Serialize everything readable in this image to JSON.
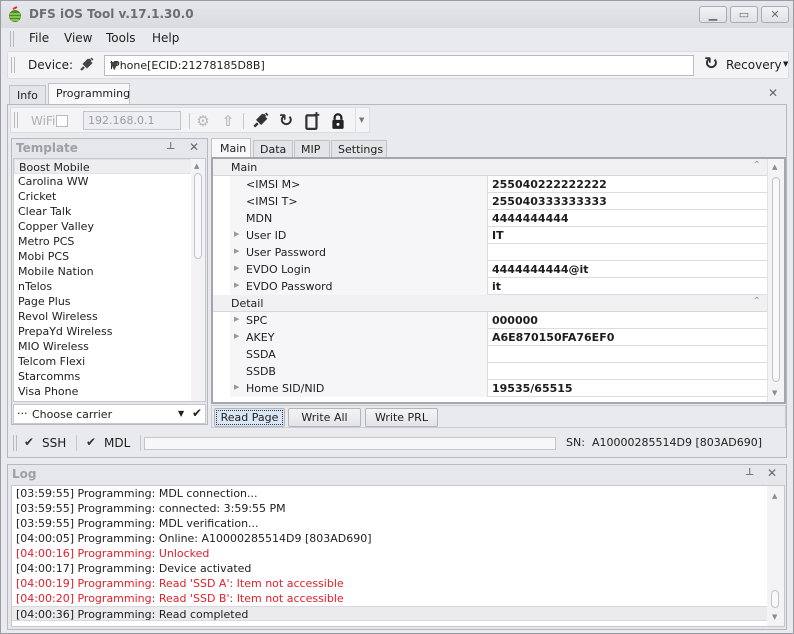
{
  "window": {
    "title": "DFS iOS Tool v.17.1.30.0",
    "controls": [
      "minimize",
      "maximize",
      "close"
    ]
  },
  "menu": [
    "File",
    "View",
    "Tools",
    "Help"
  ],
  "device_bar": {
    "label": "Device:",
    "device_value": "iPhone[ECID:21278185D8B]",
    "recovery_label": "Recovery"
  },
  "top_tabs": [
    {
      "label": "Info",
      "active": false
    },
    {
      "label": "Programming",
      "active": true
    }
  ],
  "prog_toolbar": {
    "wifi_label": "WiFi",
    "wifi_checked": false,
    "ip_value": "192.168.0.1",
    "icons": [
      "settings-icon",
      "upload-icon",
      "plug-icon",
      "refresh-icon",
      "phone-add-icon",
      "lock-icon",
      "overflow-icon"
    ]
  },
  "template": {
    "title": "Template",
    "items": [
      "Boost Mobile",
      "Carolina WW",
      "Cricket",
      "Clear Talk",
      "Copper Valley",
      "Metro PCS",
      "Mobi PCS",
      "Mobile Nation",
      "nTelos",
      "Page Plus",
      "Revol Wireless",
      "PrepaYd Wireless",
      "MIO Wireless",
      "Telcom Flexi",
      "Starcomms",
      "Visa Phone"
    ],
    "selected": "Boost Mobile",
    "carrier_placeholder": "Choose carrier"
  },
  "sub_tabs": [
    {
      "label": "Main",
      "active": true
    },
    {
      "label": "Data",
      "active": false
    },
    {
      "label": "MIP",
      "active": false
    },
    {
      "label": "Settings",
      "active": false
    }
  ],
  "property_grid": {
    "categories": [
      {
        "name": "Main",
        "rows": [
          {
            "name": "<IMSI M>",
            "value": "255040222222222",
            "expandable": false
          },
          {
            "name": "<IMSI T>",
            "value": "255040333333333",
            "expandable": false
          },
          {
            "name": "MDN",
            "value": "4444444444",
            "expandable": false
          },
          {
            "name": "User ID",
            "value": "IT",
            "expandable": true
          },
          {
            "name": "User Password",
            "value": "",
            "expandable": true
          },
          {
            "name": "EVDO Login",
            "value": "4444444444@it",
            "expandable": true
          },
          {
            "name": "EVDO Password",
            "value": "it",
            "expandable": true
          }
        ]
      },
      {
        "name": "Detail",
        "rows": [
          {
            "name": "SPC",
            "value": "000000",
            "expandable": true
          },
          {
            "name": "AKEY",
            "value": "A6E870150FA76EF0",
            "expandable": true
          },
          {
            "name": "SSDA",
            "value": "",
            "expandable": false
          },
          {
            "name": "SSDB",
            "value": "",
            "expandable": false
          },
          {
            "name": "Home SID/NID",
            "value": "19535/65515",
            "expandable": true
          }
        ]
      }
    ]
  },
  "buttons": {
    "read_page": "Read Page",
    "write_all": "Write All",
    "write_prl": "Write PRL"
  },
  "status": {
    "ssh_label": "SSH",
    "mdl_label": "MDL",
    "progress": 0,
    "sn_label": "SN:",
    "sn_value": "A10000285514D9 [803AD690]"
  },
  "log": {
    "title": "Log",
    "lines": [
      {
        "text": "[03:59:55] Programming: MDL connection...",
        "error": false
      },
      {
        "text": "[03:59:55] Programming: connected: 3:59:55 PM",
        "error": false
      },
      {
        "text": "[03:59:55] Programming: MDL verification...",
        "error": false
      },
      {
        "text": "[04:00:05] Programming: Online: A10000285514D9 [803AD690]",
        "error": false
      },
      {
        "text": "[04:00:16] Programming: Unlocked",
        "error": true
      },
      {
        "text": "[04:00:17] Programming: Device activated",
        "error": false
      },
      {
        "text": "[04:00:19] Programming: Read 'SSD A': Item not accessible",
        "error": true
      },
      {
        "text": "[04:00:20] Programming: Read 'SSD B': Item not accessible",
        "error": true
      },
      {
        "text": "[04:00:36] Programming: Read completed",
        "error": false
      }
    ]
  },
  "colors": {
    "error_text": "#e0202a",
    "accent_focus": "#d9e6f6"
  }
}
